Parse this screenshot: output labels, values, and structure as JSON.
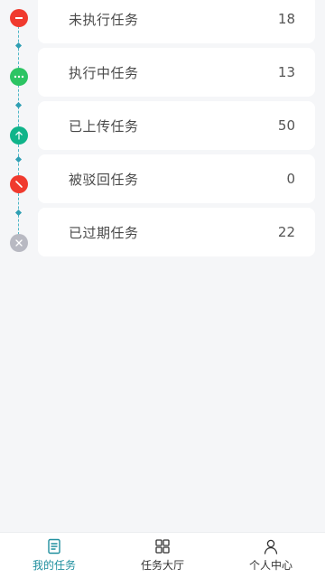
{
  "tasks": [
    {
      "label": "未执行任务",
      "count": "18",
      "icon": "minus-circle-icon",
      "color": "#f03a2e"
    },
    {
      "label": "执行中任务",
      "count": "13",
      "icon": "ellipsis-circle-icon",
      "color": "#2cc463"
    },
    {
      "label": "已上传任务",
      "count": "50",
      "icon": "upload-arrow-icon",
      "color": "#10b48a"
    },
    {
      "label": "被驳回任务",
      "count": "0",
      "icon": "slash-circle-icon",
      "color": "#f03a2e"
    },
    {
      "label": "已过期任务",
      "count": "22",
      "icon": "x-circle-icon",
      "color": "#b8b9c2"
    }
  ],
  "nav": {
    "items": [
      {
        "label": "我的任务",
        "icon": "task-list-icon",
        "active": true
      },
      {
        "label": "任务大厅",
        "icon": "grid-icon",
        "active": false
      },
      {
        "label": "个人中心",
        "icon": "user-icon",
        "active": false
      }
    ],
    "active_color": "#1f8f9e"
  }
}
